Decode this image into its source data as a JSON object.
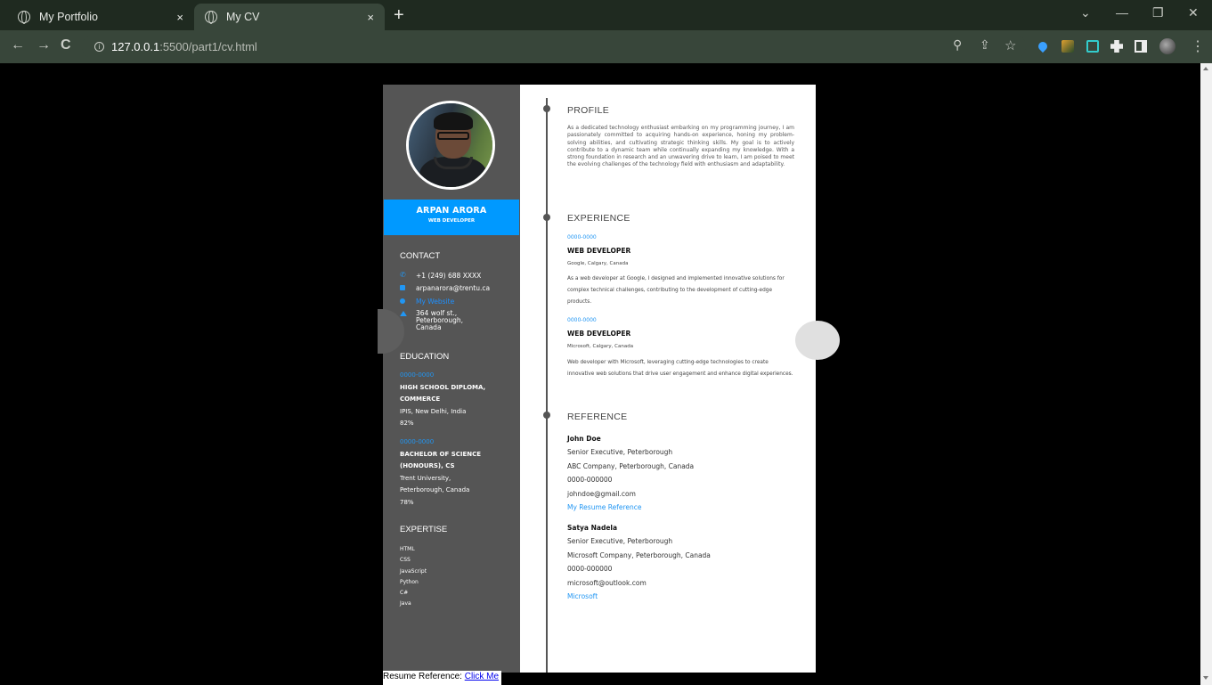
{
  "browser": {
    "tabs": [
      {
        "title": "My Portfolio",
        "close": "×"
      },
      {
        "title": "My CV",
        "close": "×"
      }
    ],
    "new_tab": "+",
    "url_host": "127.0.0.1",
    "url_path": ":5500/part1/cv.html",
    "window_controls": {
      "dropdown": "⌄",
      "minimize": "—",
      "restore": "❐",
      "close": "✕"
    },
    "nav": {
      "back": "←",
      "forward": "→",
      "reload": "C"
    },
    "toolbar_icons": {
      "zoom": "⚲",
      "share": "⇪",
      "bookmark": "☆",
      "menu": "⋮"
    }
  },
  "cv": {
    "name": "ARPAN ARORA",
    "role": "WEB DEVELOPER",
    "contact": {
      "heading": "CONTACT",
      "phone": "+1 (249) 688 XXXX",
      "email": "arpanarora@trentu.ca",
      "website": "My Website",
      "address": [
        "364 wolf st.,",
        "Peterborough,",
        "Canada"
      ]
    },
    "education": {
      "heading": "EDUCATION",
      "items": [
        {
          "years": "0000-0000",
          "degree_1": "HIGH SCHOOL DIPLOMA,",
          "degree_2": "COMMERCE",
          "school": "IPIS, New Delhi, India",
          "score": "82%"
        },
        {
          "years": "0000-0000",
          "degree_1": "BACHELOR OF SCIENCE",
          "degree_2": "(HONOURS), CS",
          "school": "Trent University,",
          "school_2": "Peterborough, Canada",
          "score": "78%"
        }
      ]
    },
    "expertise": {
      "heading": "EXPERTISE",
      "items": [
        "HTML",
        "CSS",
        "JavaScript",
        "Python",
        "C#",
        "Java"
      ]
    },
    "profile": {
      "heading": "PROFILE",
      "text": "As a dedicated technology enthusiast embarking on my programming journey, I am passionately committed to acquiring hands-on experience, honing my problem-solving abilities, and cultivating strategic thinking skills. My goal is to actively contribute to a dynamic team while continually expanding my knowledge. With a strong foundation in research and an unwavering drive to learn, I am poised to meet the evolving challenges of the technology field with enthusiasm and adaptability."
    },
    "experience": {
      "heading": "EXPERIENCE",
      "items": [
        {
          "years": "0000-0000",
          "title": "WEB DEVELOPER",
          "company": "Google, Calgary, Canada",
          "desc": "As a web developer at Google, I designed and implemented innovative solutions for complex technical challenges, contributing to the development of cutting-edge products."
        },
        {
          "years": "0000-0000",
          "title": "WEB DEVELOPER",
          "company": "Microsoft, Calgary, Canada",
          "desc": "Web developer with Microsoft, leveraging cutting-edge technologies to create innovative web solutions that drive user engagement and enhance digital experiences."
        }
      ]
    },
    "reference": {
      "heading": "REFERENCE",
      "items": [
        {
          "name": "John Doe",
          "position": "Senior Executive, Peterborough",
          "company": "ABC Company, Peterborough, Canada",
          "phone": "0000-000000",
          "email": "johndoe@gmail.com",
          "link": "My Resume Reference"
        },
        {
          "name": "Satya Nadela",
          "position": "Senior Executive, Peterborough",
          "company": "Microsoft Company, Peterborough, Canada",
          "phone": "0000-000000",
          "email": "microsoft@outlook.com",
          "link": "Microsoft"
        }
      ]
    }
  },
  "footer": {
    "label": "Resume Reference: ",
    "link": "Click Me"
  },
  "colors": {
    "accent": "#0099ff",
    "sidebar": "#555555",
    "page_bg": "#000000"
  }
}
